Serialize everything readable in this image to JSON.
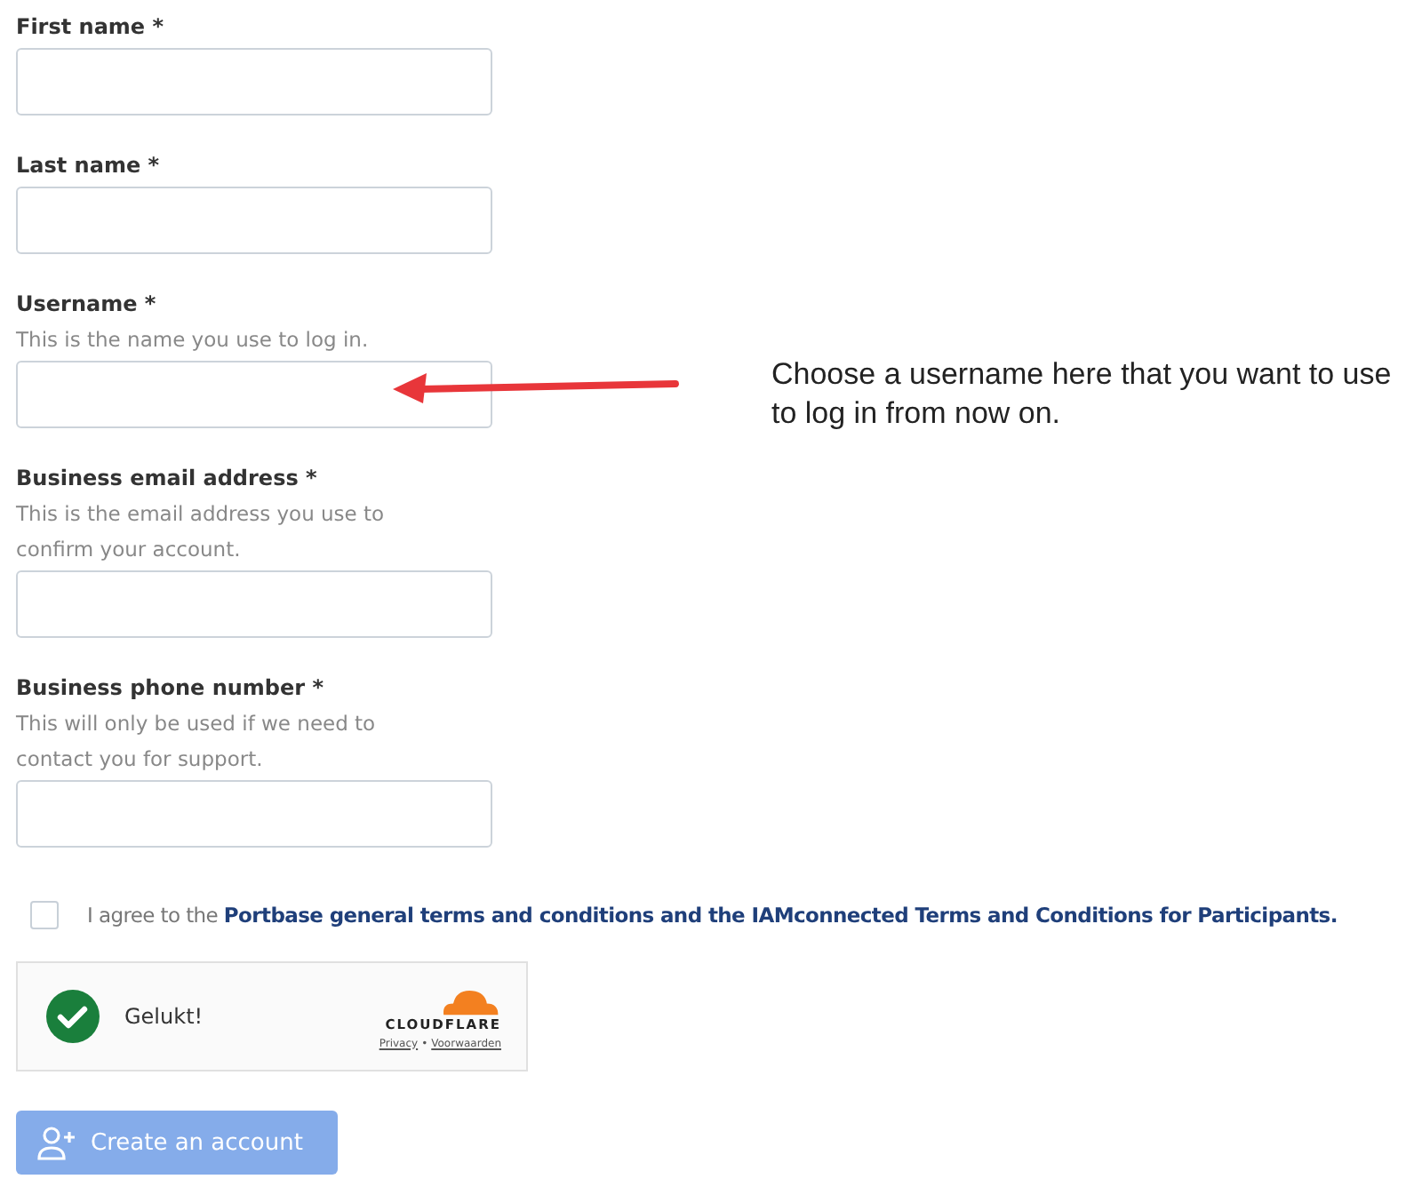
{
  "fields": [
    {
      "label": "First name *"
    },
    {
      "label": "Last name *"
    },
    {
      "label": "Username *",
      "hint": "This is the name you use to log in."
    },
    {
      "label": "Business email address *",
      "hint": "This is the email address you use to confirm your account."
    },
    {
      "label": "Business phone number *",
      "hint": "This will only be used if we need to contact you for support."
    }
  ],
  "agreement": {
    "checked": false,
    "text": "I agree to the",
    "link": "Portbase general terms and conditions and the IAMconnected Terms and Conditions for Participants."
  },
  "captcha": {
    "status": "Gelukt!",
    "brand": "CLOUDFLARE",
    "privacy": "Privacy",
    "separator": "•",
    "terms": "Voorwaarden"
  },
  "submit": {
    "label": "Create an account",
    "disabled": true
  },
  "annotation": {
    "text": "Choose a username here that you want to use to log in from now on."
  }
}
